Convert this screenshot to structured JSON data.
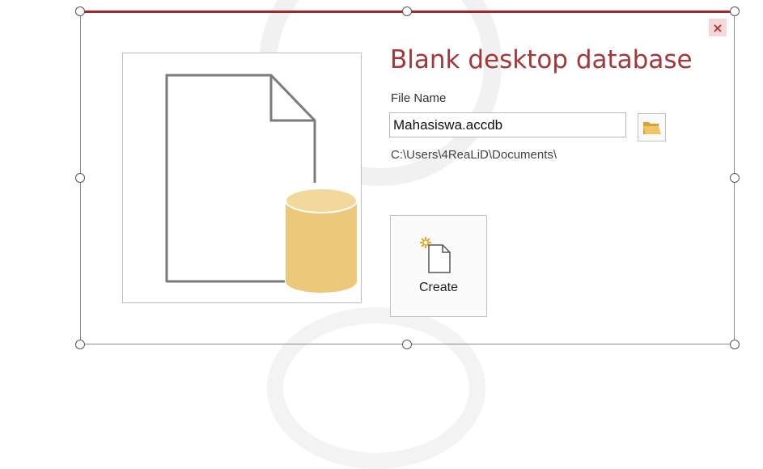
{
  "dialog": {
    "title": "Blank desktop database",
    "close_icon": "×",
    "file_name_label": "File Name",
    "file_name_value": "Mahasiswa.accdb",
    "path": "C:\\Users\\4ReaLiD\\Documents\\",
    "create_label": "Create"
  },
  "icons": {
    "preview": "document-database-icon",
    "browse": "folder-icon",
    "create": "new-document-icon",
    "close": "close-icon"
  },
  "colors": {
    "accent": "#a4373a",
    "close_bg": "#f5d8d8",
    "database": "#ecc87a",
    "folder": "#e8b64c"
  }
}
